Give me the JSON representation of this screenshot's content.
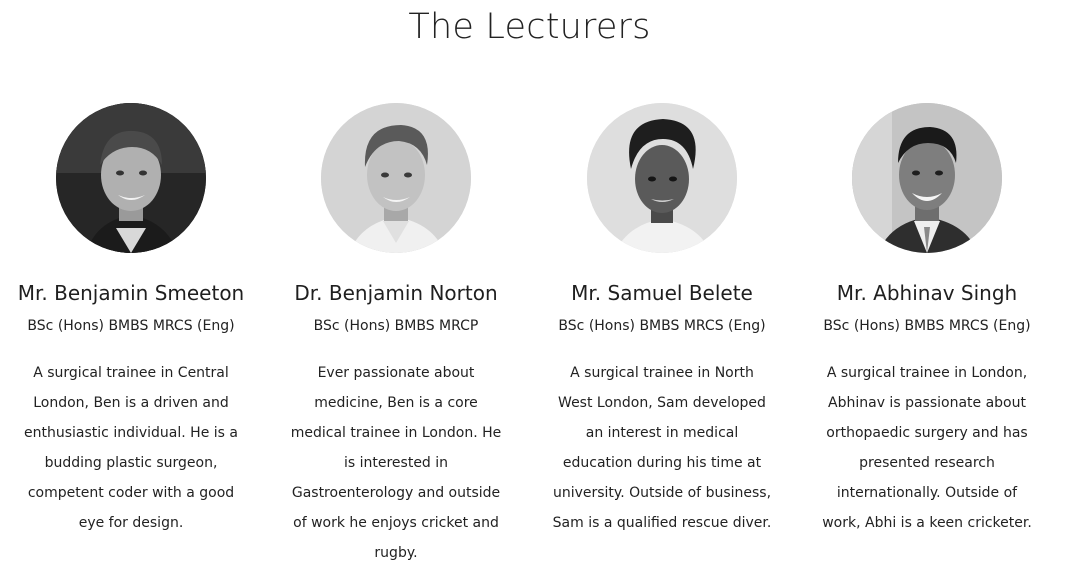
{
  "section": {
    "title": "The Lecturers"
  },
  "lecturers": [
    {
      "name": "Mr. Benjamin Smeeton",
      "credentials": "BSc (Hons) BMBS MRCS (Eng)",
      "bio": "A surgical trainee in Central London, Ben is a driven and enthusiastic individual. He is a budding plastic surgeon, competent coder with a good eye for design.",
      "photo": "portrait-photo"
    },
    {
      "name": "Dr. Benjamin Norton",
      "credentials": "BSc (Hons) BMBS MRCP",
      "bio": "Ever passionate about medicine, Ben is a core medical trainee in London. He is interested in Gastroenterology and outside of work he enjoys cricket and rugby.",
      "photo": "portrait-photo"
    },
    {
      "name": "Mr. Samuel Belete",
      "credentials": "BSc (Hons) BMBS MRCS (Eng)",
      "bio": "A surgical trainee in North West London, Sam developed an interest in medical education during his time at university. Outside of business, Sam is a qualified rescue diver.",
      "photo": "portrait-photo"
    },
    {
      "name": "Mr. Abhinav Singh",
      "credentials": "BSc (Hons) BMBS MRCS (Eng)",
      "bio": "A surgical trainee in London, Abhinav is passionate about orthopaedic surgery and has presented research internationally. Outside of work, Abhi is a keen cricketer.",
      "photo": "portrait-photo"
    }
  ],
  "colors": {
    "text": "#1f1f1f",
    "background": "#ffffff"
  }
}
